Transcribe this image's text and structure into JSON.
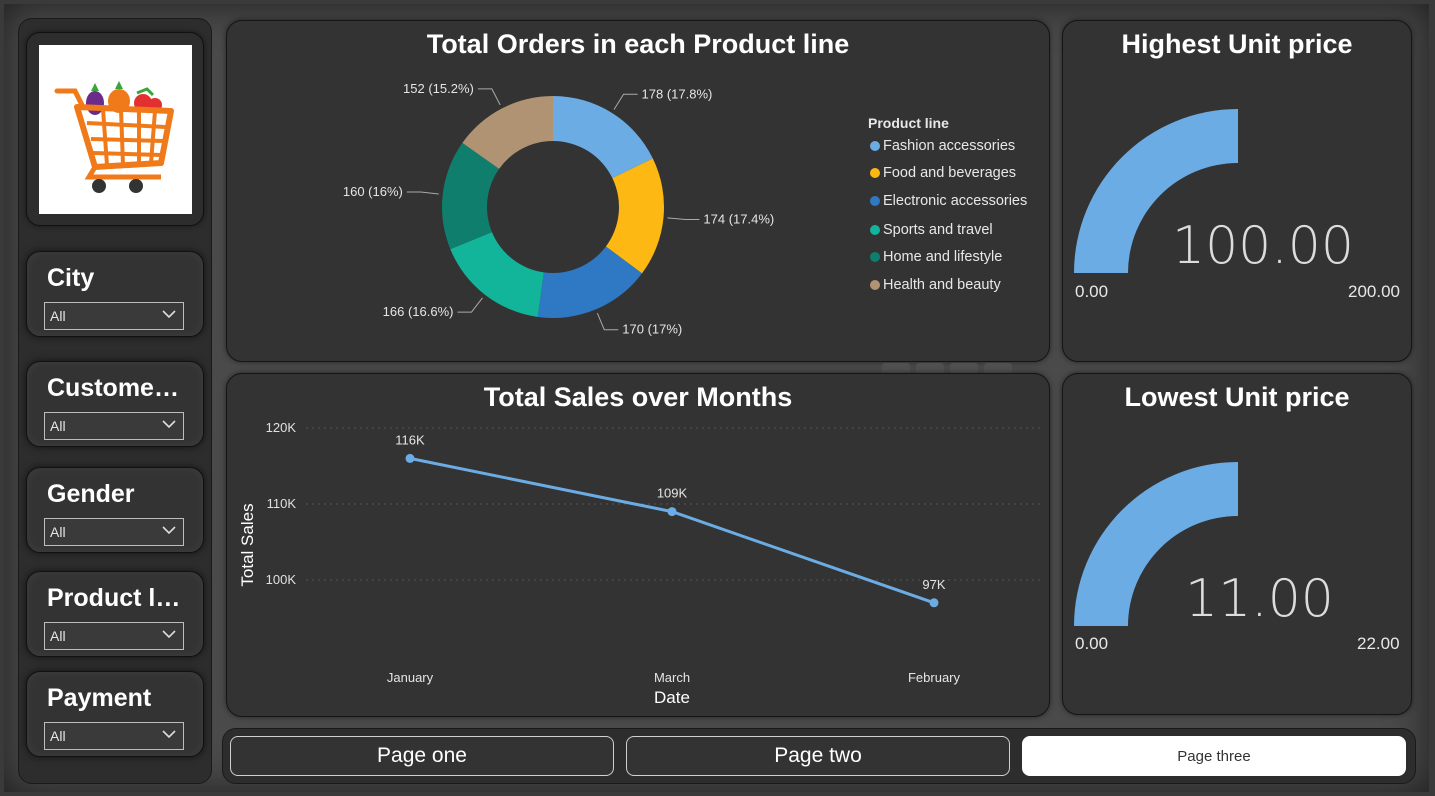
{
  "slicers": [
    {
      "title": "City",
      "value": "All"
    },
    {
      "title": "Customer type",
      "value": "All"
    },
    {
      "title": "Gender",
      "value": "All"
    },
    {
      "title": "Product line",
      "value": "All"
    },
    {
      "title": "Payment",
      "value": "All"
    }
  ],
  "donut": {
    "title": "Total Orders in each Product line",
    "legend_title": "Product line",
    "labels": [
      "178 (17.8%)",
      "174 (17.4%)",
      "170 (17%)",
      "166 (16.6%)",
      "160 (16%)",
      "152 (15.2%)"
    ]
  },
  "line": {
    "title": "Total Sales over Months",
    "xlabel": "Date",
    "ylabel": "Total Sales",
    "yticks": [
      "120K",
      "110K",
      "100K"
    ],
    "data_labels": [
      "116K",
      "109K",
      "97K"
    ]
  },
  "gauge_high": {
    "title": "Highest Unit price",
    "value": "100.00",
    "min": "0.00",
    "max": "200.00",
    "fill": 0.5
  },
  "gauge_low": {
    "title": "Lowest Unit price",
    "value": "11.00",
    "min": "0.00",
    "max": "22.00",
    "fill": 0.5
  },
  "nav": {
    "page1": "Page one",
    "page2": "Page two",
    "page3": "Page three"
  },
  "colors": {
    "fashion": "#6CACE4",
    "food": "#FDB813",
    "electronic": "#2F78C4",
    "sports": "#13B59A",
    "home": "#0F7E6D",
    "health": "#B09373",
    "line": "#6CACE4",
    "gauge": "#6CACE4"
  },
  "chart_data": [
    {
      "type": "pie",
      "title": "Total Orders in each Product line",
      "legend_title": "Product line",
      "categories": [
        "Fashion accessories",
        "Food and beverages",
        "Electronic accessories",
        "Sports and travel",
        "Home and lifestyle",
        "Health and beauty"
      ],
      "values": [
        178,
        174,
        170,
        166,
        160,
        152
      ],
      "percent": [
        17.8,
        17.4,
        17.0,
        16.6,
        16.0,
        15.2
      ],
      "legend_position": "right"
    },
    {
      "type": "line",
      "title": "Total Sales over Months",
      "xlabel": "Date",
      "ylabel": "Total Sales",
      "categories": [
        "January",
        "March",
        "February"
      ],
      "values": [
        116000,
        109000,
        97000
      ],
      "ylim": [
        95000,
        120000
      ],
      "yticks": [
        100000,
        110000,
        120000
      ],
      "grid": true
    }
  ]
}
